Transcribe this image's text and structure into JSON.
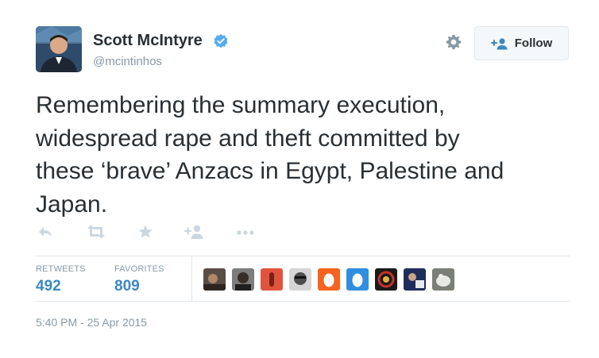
{
  "profile": {
    "name": "Scott McIntyre",
    "handle": "@mcintinhos",
    "verified": true,
    "avatar_icon": "user-photo-avatar"
  },
  "header_actions": {
    "settings_icon": "gear-icon",
    "follow_label": "Follow",
    "follow_icon": "add-user-icon"
  },
  "tweet": {
    "line1": "Remembering the summary execution,",
    "line2": "widespread rape and theft committed by",
    "line3": "these ‘brave’ Anzacs in Egypt, Palestine and",
    "line4": "Japan."
  },
  "action_bar": {
    "icons": [
      "reply-icon",
      "retweet-icon",
      "favorite-star-icon",
      "follow-icon",
      "more-options-icon"
    ]
  },
  "stats": {
    "retweets_label": "RETWEETS",
    "retweets_count": "492",
    "favorites_label": "FAVORITES",
    "favorites_count": "809"
  },
  "favoriters": {
    "count_shown": 9
  },
  "meta": {
    "timestamp": "5:40 PM - 25 Apr 2015"
  },
  "colors": {
    "text": "#292f33",
    "muted": "#8899a6",
    "stat_value": "#3b88c3",
    "verified": "#55acee",
    "follow_icon": "#3b88c3",
    "border": "#e1e8ed"
  }
}
